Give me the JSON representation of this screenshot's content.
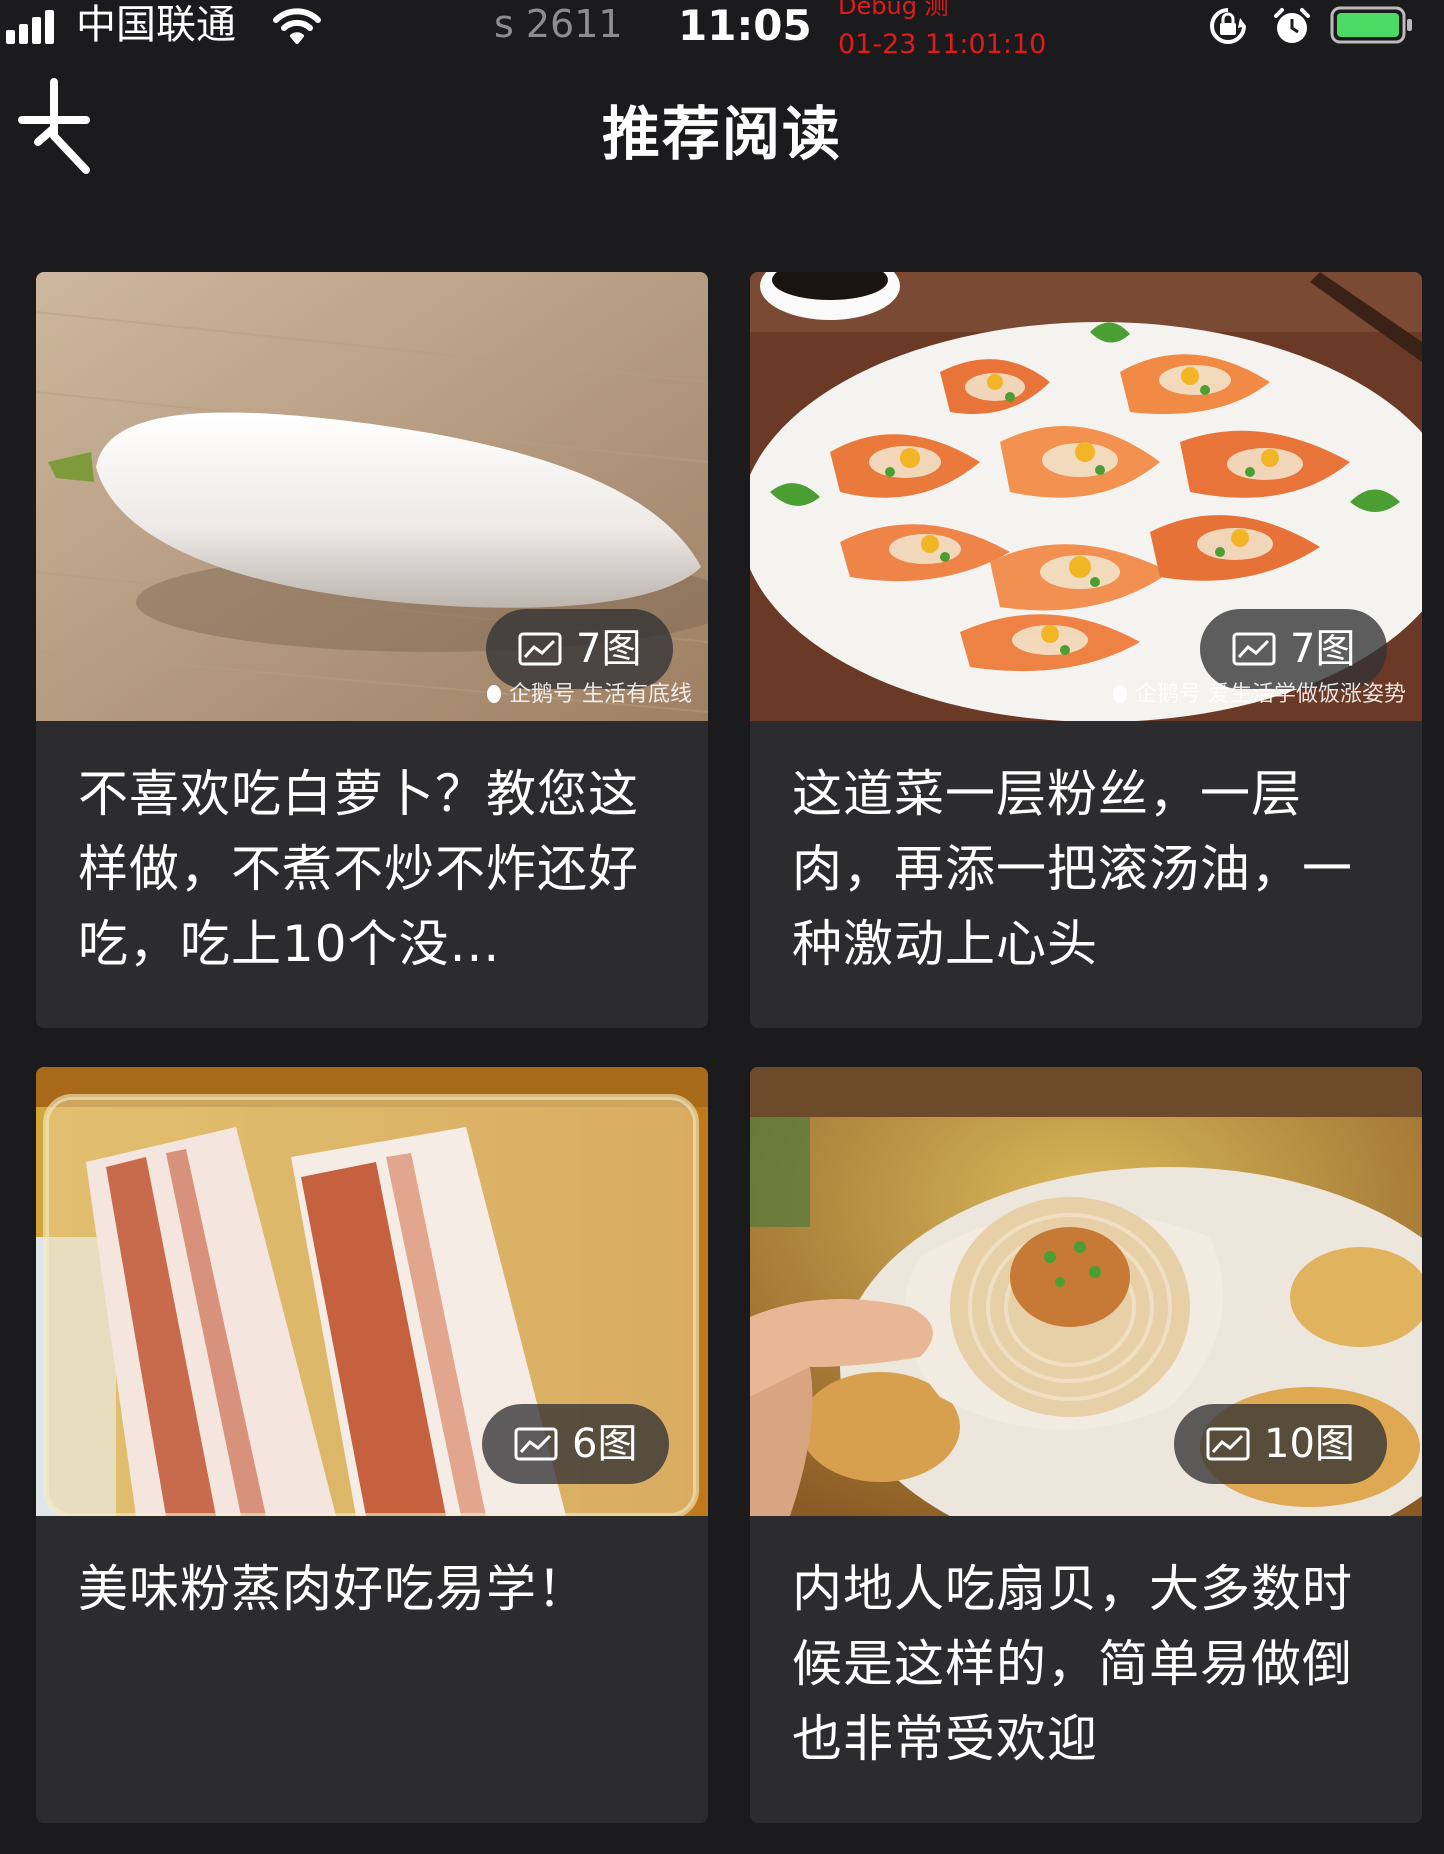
{
  "status_bar": {
    "carrier": "中国联通",
    "debug_s": "s 2611",
    "time": "11:05",
    "debug_label": "Debug 测",
    "debug_time": "01-23 11:01:10",
    "icons": [
      "signal-icon",
      "wifi-icon",
      "orientation-lock-icon",
      "alarm-icon",
      "battery-icon"
    ],
    "battery_color": "#4cd964"
  },
  "nav": {
    "title": "推荐阅读",
    "back_icon": "tencent-video-logo-icon"
  },
  "cards": [
    {
      "image_count": "7图",
      "watermark": "企鹅号 生活有底线",
      "title": "不喜欢吃白萝卜？教您这样做，不煮不炒不炸还好吃，吃上10个没..."
    },
    {
      "image_count": "7图",
      "watermark": "企鹅号 爱生活学做饭涨姿势",
      "title": "这道菜一层粉丝，一层肉，再添一把滚汤油，一种激动上心头"
    },
    {
      "image_count": "6图",
      "watermark": "",
      "title": "美味粉蒸肉好吃易学！"
    },
    {
      "image_count": "10图",
      "watermark": "",
      "title": "内地人吃扇贝，大多数时候是这样的，简单易做倒也非常受欢迎"
    }
  ],
  "colors": {
    "background": "#1b1b1d",
    "card": "#2c2c2e",
    "debug_text": "#e11b1b"
  }
}
